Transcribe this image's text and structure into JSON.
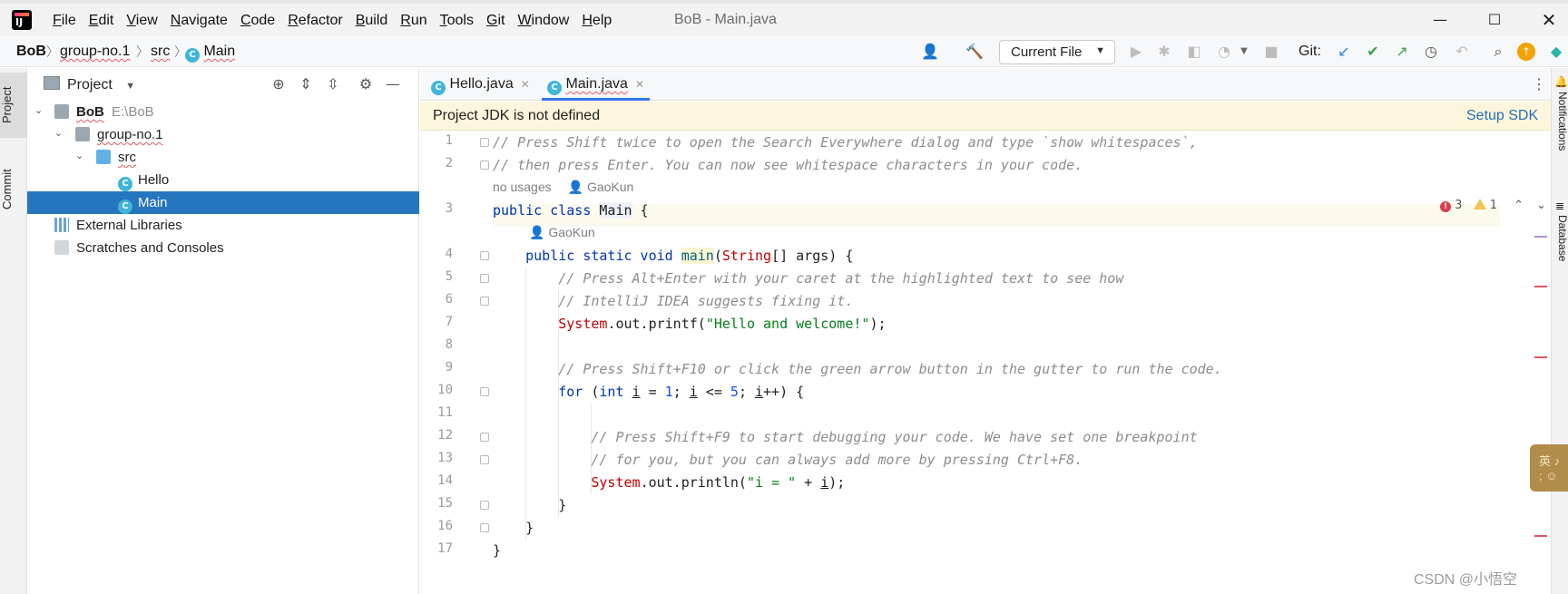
{
  "window": {
    "title": "BoB - Main.java",
    "menu": [
      "File",
      "Edit",
      "View",
      "Navigate",
      "Code",
      "Refactor",
      "Build",
      "Run",
      "Tools",
      "Git",
      "Window",
      "Help"
    ],
    "minimize": "—",
    "maximize": "☐",
    "close": "✕"
  },
  "navbar": {
    "breadcrumbs": [
      "BoB",
      "group-no.1",
      "src",
      "Main"
    ],
    "run_config": "Current File",
    "git_label": "Git:"
  },
  "left_stripe": {
    "project": "Project",
    "commit": "Commit"
  },
  "project_panel": {
    "title": "Project",
    "tree": [
      {
        "label": "BoB",
        "path": "E:\\BoB"
      },
      {
        "label": "group-no.1"
      },
      {
        "label": "src"
      },
      {
        "label": "Hello"
      },
      {
        "label": "Main"
      },
      {
        "label": "External Libraries"
      },
      {
        "label": "Scratches and Consoles"
      }
    ]
  },
  "editor": {
    "tabs": [
      "Hello.java",
      "Main.java"
    ],
    "banner": {
      "text": "Project JDK is not defined",
      "action": "Setup SDK"
    },
    "inspection": {
      "errors": "3",
      "warnings": "1"
    },
    "line_numbers": [
      "1",
      "2",
      "3",
      "4",
      "5",
      "6",
      "7",
      "8",
      "9",
      "10",
      "11",
      "12",
      "13",
      "14",
      "15",
      "16",
      "17"
    ],
    "hints": {
      "usages": "no usages",
      "author": "GaoKun"
    },
    "code": {
      "l1": "// Press Shift twice to open the Search Everywhere dialog and type `show whitespaces`,",
      "l2": "// then press Enter. You can now see whitespace characters in your code.",
      "l5": "// Press Alt+Enter with your caret at the highlighted text to see how",
      "l6": "// IntelliJ IDEA suggests fixing it.",
      "l7_str": "\"Hello and welcome!\"",
      "l9": "// Press Shift+F10 or click the green arrow button in the gutter to run the code.",
      "l12": "// Press Shift+F9 to start debugging your code. We have set one breakpoint",
      "l13": "// for you, but you can always add more by pressing Ctrl+F8.",
      "l14_str": "\"i = \""
    }
  },
  "right_stripe": {
    "notifications": "Notifications",
    "database": "Database"
  },
  "ime_popup": {
    "line1": "英 ♪",
    "line2": "; ☺"
  },
  "watermark": "CSDN @小悟空"
}
